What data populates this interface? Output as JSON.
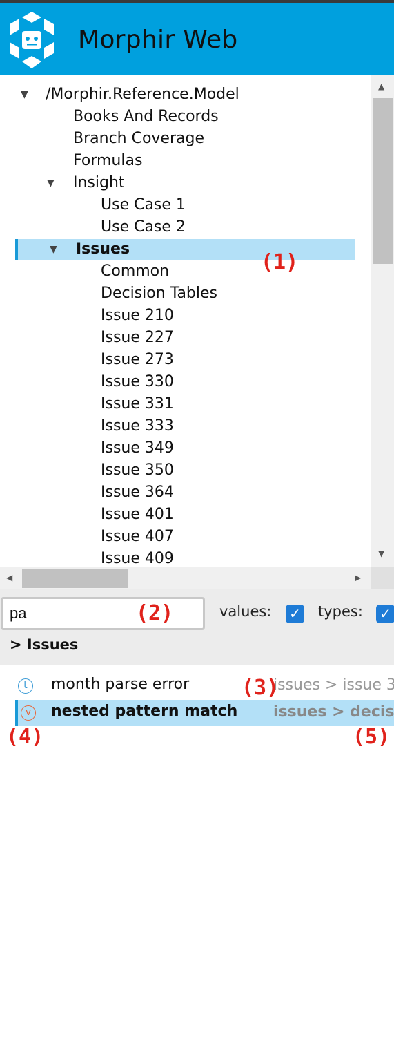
{
  "app": {
    "title": "Morphir Web"
  },
  "tree": {
    "root": "/Morphir.Reference.Model",
    "items": [
      {
        "label": "Books And Records"
      },
      {
        "label": "Branch Coverage"
      },
      {
        "label": "Formulas"
      },
      {
        "label": "Insight"
      },
      {
        "label": "Use Case 1"
      },
      {
        "label": "Use Case 2"
      },
      {
        "label": "Issues"
      },
      {
        "label": "Common"
      },
      {
        "label": "Decision Tables"
      },
      {
        "label": "Issue 210"
      },
      {
        "label": "Issue 227"
      },
      {
        "label": "Issue 273"
      },
      {
        "label": "Issue 330"
      },
      {
        "label": "Issue 331"
      },
      {
        "label": "Issue 333"
      },
      {
        "label": "Issue 349"
      },
      {
        "label": "Issue 350"
      },
      {
        "label": "Issue 364"
      },
      {
        "label": "Issue 401"
      },
      {
        "label": "Issue 407"
      },
      {
        "label": "Issue 409"
      }
    ]
  },
  "search": {
    "value": "pa",
    "values_label": "values:",
    "types_label": "types:",
    "values_checked": true,
    "types_checked": true
  },
  "breadcrumb": "> Issues",
  "results": [
    {
      "icon": "t",
      "name": "month parse error",
      "path": "issues > issue 3"
    },
    {
      "icon": "v",
      "name": "nested pattern match",
      "path": "issues > decisio"
    }
  ],
  "callouts": [
    "(1)",
    "(2)",
    "(3)",
    "(4)",
    "(5)"
  ],
  "colors": {
    "header": "#00a0de",
    "selection": "#b3e0f7",
    "accent": "#1a9ad7",
    "checkbox": "#1e7bd6",
    "type_icon": "#3b9bd6",
    "value_icon": "#e8663a",
    "callout": "#e0221b"
  },
  "icons": {
    "logo": "morphir-logo-icon",
    "expand": "caret-down-icon",
    "check": "checkmark-icon"
  }
}
